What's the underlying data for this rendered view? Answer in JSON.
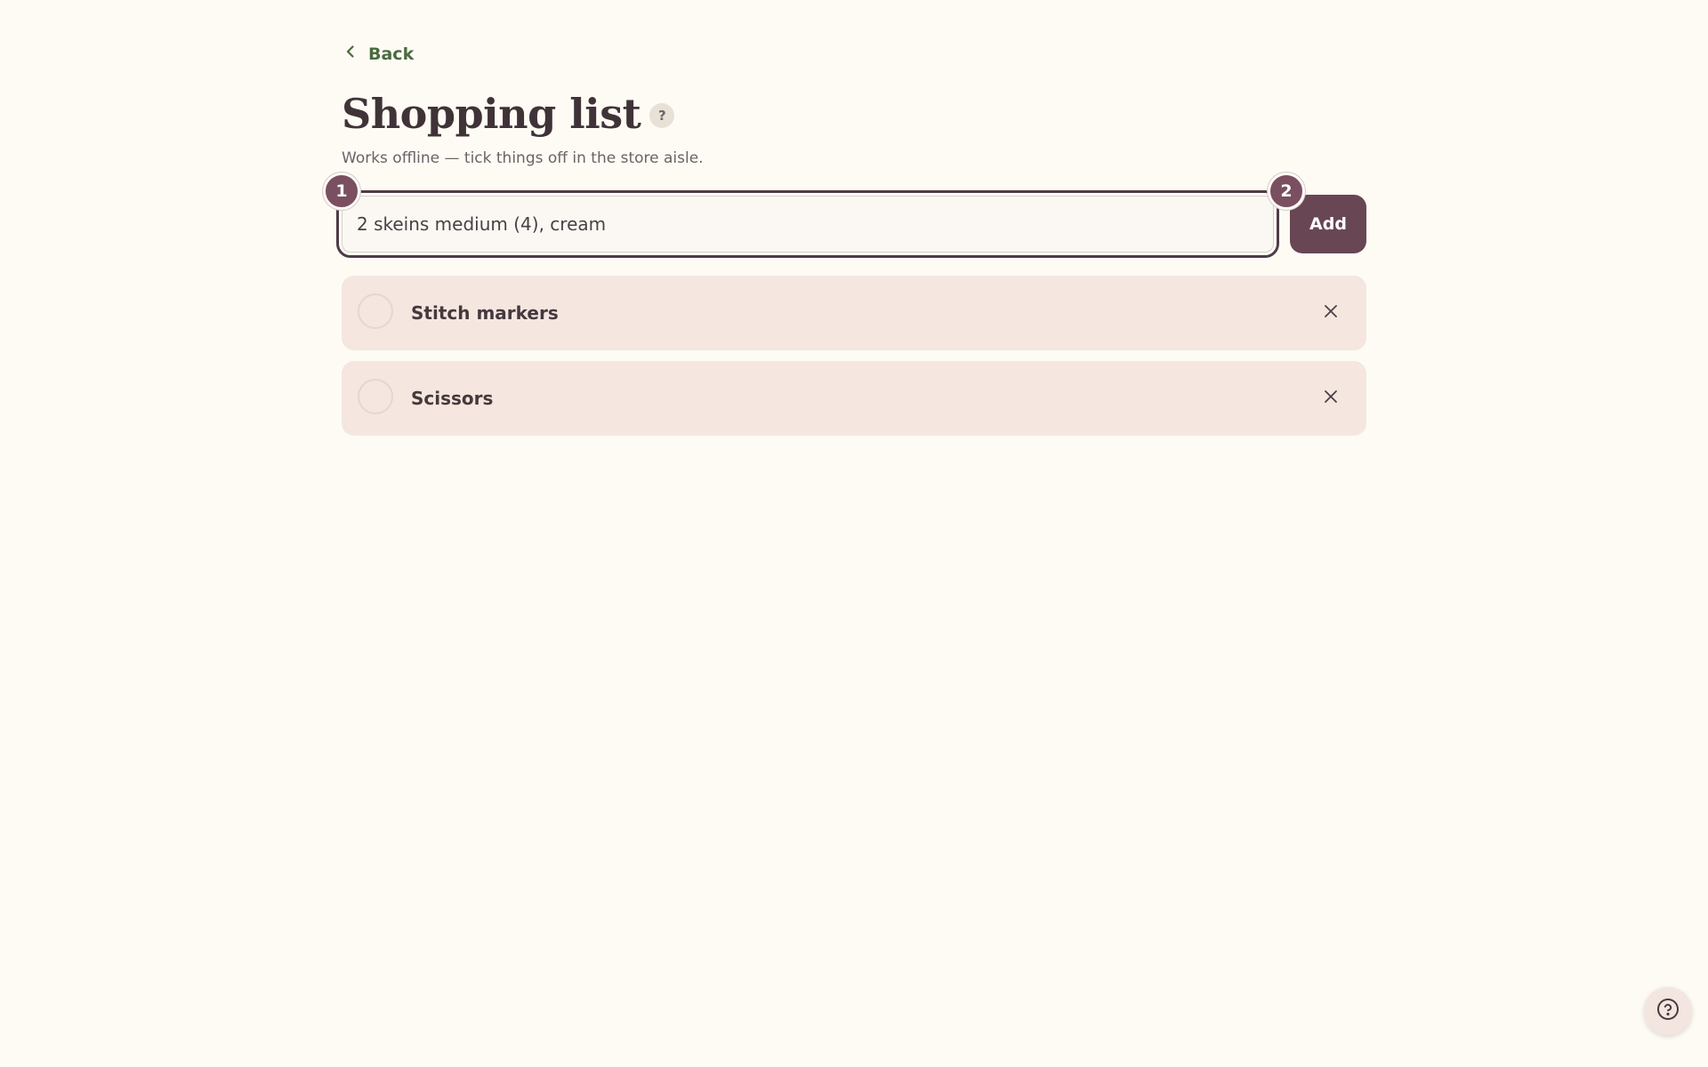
{
  "nav": {
    "back_label": "Back",
    "back_icon": "chevron-left-icon"
  },
  "header": {
    "title": "Shopping list",
    "help_badge": "?",
    "subtitle": "Works offline — tick things off in the store aisle."
  },
  "add_form": {
    "input_value": "2 skeins medium (4), cream",
    "add_label": "Add",
    "step_badges": [
      "1",
      "2"
    ]
  },
  "items": [
    {
      "label": "Stitch markers",
      "checked": false
    },
    {
      "label": "Scissors",
      "checked": false
    }
  ],
  "floating": {
    "help_icon": "help-circle-icon"
  },
  "colors": {
    "background": "#fefbf5",
    "accent": "#684654",
    "badge": "#7a4f60",
    "link": "#4a6b3e",
    "item_background": "#f5e6e0"
  }
}
